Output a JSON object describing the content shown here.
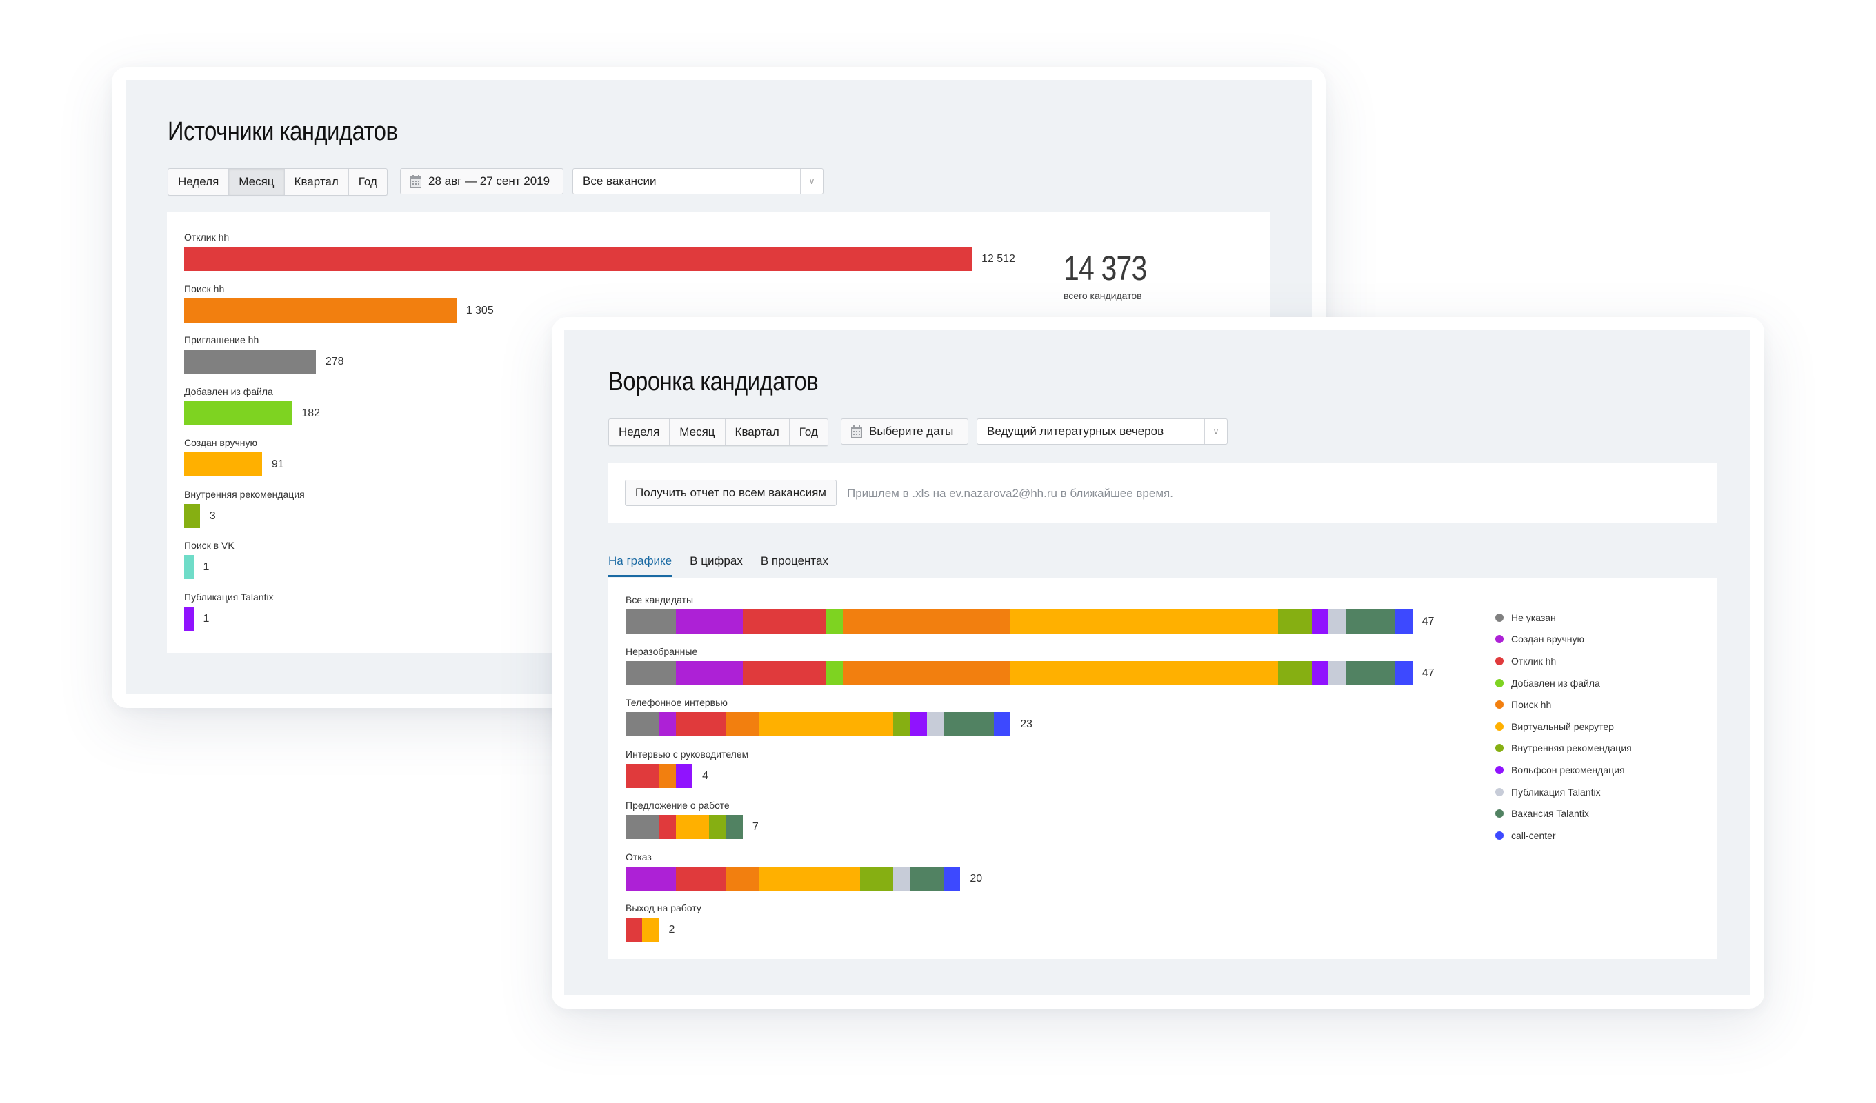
{
  "panel_sources": {
    "title": "Источники кандидатов",
    "periods": [
      "Неделя",
      "Месяц",
      "Квартал",
      "Год"
    ],
    "active_period": "Месяц",
    "date_range": "28 авг — 27 сент 2019",
    "vacancy_select": "Все вакансии",
    "total": {
      "value": "14 373",
      "label": "всего кандидатов"
    }
  },
  "panel_funnel": {
    "title": "Воронка кандидатов",
    "periods": [
      "Неделя",
      "Месяц",
      "Квартал",
      "Год"
    ],
    "date_placeholder": "Выберите даты",
    "vacancy_select": "Ведущий литературных вечеров",
    "report_button": "Получить отчет по всем вакансиям",
    "report_note": "Пришлем в .xls на ev.nazarova2@hh.ru в ближайшее время.",
    "tabs": [
      "На графике",
      "В цифрах",
      "В процентах"
    ],
    "active_tab": "На графике"
  },
  "chart_data": [
    {
      "type": "bar",
      "orientation": "horizontal",
      "title": "Источники кандидатов",
      "categories": [
        "Отклик hh",
        "Поиск hh",
        "Приглашение hh",
        "Добавлен из файла",
        "Создан вручную",
        "Внутренняя рекомендация",
        "Поиск в VK",
        "Публикация Talantix"
      ],
      "values": [
        12512,
        1305,
        278,
        182,
        91,
        3,
        1,
        1
      ],
      "value_labels": [
        "12 512",
        "1 305",
        "278",
        "182",
        "91",
        "3",
        "1",
        "1"
      ],
      "colors": [
        "#e03a3c",
        "#f27f0f",
        "#808080",
        "#7ed321",
        "#ffb000",
        "#86af12",
        "#6fdcc8",
        "#9013fe"
      ],
      "total": 14373,
      "total_label": "всего кандидатов",
      "scale": "non-linear (bar lengths are compressed)"
    },
    {
      "type": "bar",
      "orientation": "horizontal",
      "stacked": true,
      "title": "Воронка кандидатов",
      "categories": [
        "Все кандидаты",
        "Неразобранные",
        "Телефонное интервью",
        "Интервью с руководителем",
        "Предложение о работе",
        "Отказ",
        "Выход на работу"
      ],
      "totals": [
        47,
        47,
        23,
        4,
        7,
        20,
        2
      ],
      "legend_position": "right",
      "series": [
        {
          "name": "Не указан",
          "color": "#808080",
          "values": [
            3,
            3,
            2,
            0,
            2,
            0,
            0
          ]
        },
        {
          "name": "Создан вручную",
          "color": "#ad21d6",
          "values": [
            4,
            4,
            1,
            0,
            0,
            3,
            0
          ]
        },
        {
          "name": "Отклик hh",
          "color": "#e03a3c",
          "values": [
            5,
            5,
            3,
            2,
            1,
            3,
            1
          ]
        },
        {
          "name": "Добавлен из файла",
          "color": "#7ed321",
          "values": [
            1,
            1,
            0,
            0,
            0,
            0,
            0
          ]
        },
        {
          "name": "Поиск hh",
          "color": "#f27f0f",
          "values": [
            10,
            10,
            2,
            1,
            0,
            2,
            0
          ]
        },
        {
          "name": "Виртуальный рекрутер",
          "color": "#ffb000",
          "values": [
            16,
            16,
            8,
            0,
            2,
            6,
            1
          ]
        },
        {
          "name": "Внутренняя рекомендация",
          "color": "#86af12",
          "values": [
            2,
            2,
            1,
            0,
            1,
            2,
            0
          ]
        },
        {
          "name": "Вольфсон рекомендация",
          "color": "#9013fe",
          "values": [
            1,
            1,
            1,
            1,
            0,
            0,
            0
          ]
        },
        {
          "name": "Публикация Talantix",
          "color": "#c7ccd8",
          "values": [
            1,
            1,
            1,
            0,
            0,
            1,
            0
          ]
        },
        {
          "name": "Вакансия Talantix",
          "color": "#518262",
          "values": [
            3,
            3,
            3,
            0,
            1,
            2,
            0
          ]
        },
        {
          "name": "call-center",
          "color": "#3d49ff",
          "values": [
            1,
            1,
            1,
            0,
            0,
            1,
            0
          ]
        }
      ]
    }
  ]
}
